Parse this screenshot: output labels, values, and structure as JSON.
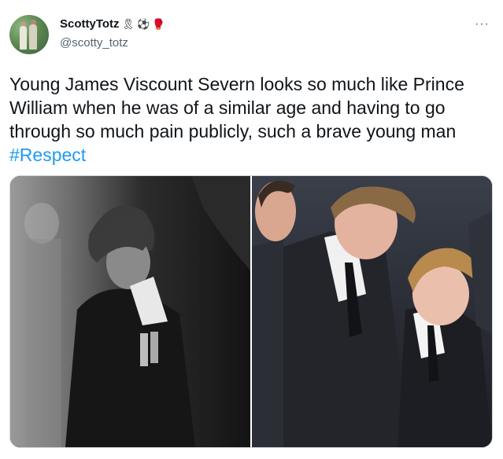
{
  "tweet": {
    "display_name": "ScottyTotz",
    "handle": "@scotty_totz",
    "badges": [
      "🎗",
      "⚽",
      "🥊"
    ],
    "more_icon": "more-horizontal-icon",
    "text": "Young James Viscount Severn looks so much like Prince William when he was of a similar age and having to go through so much pain publicly, such a brave young man",
    "hashtag": "#Respect"
  },
  "media": {
    "images": [
      {
        "description": "black and white photo of a boy in a dark suit with medals, head bowed"
      },
      {
        "description": "colour photo of two boys in dark suits with heads bowed"
      }
    ]
  }
}
